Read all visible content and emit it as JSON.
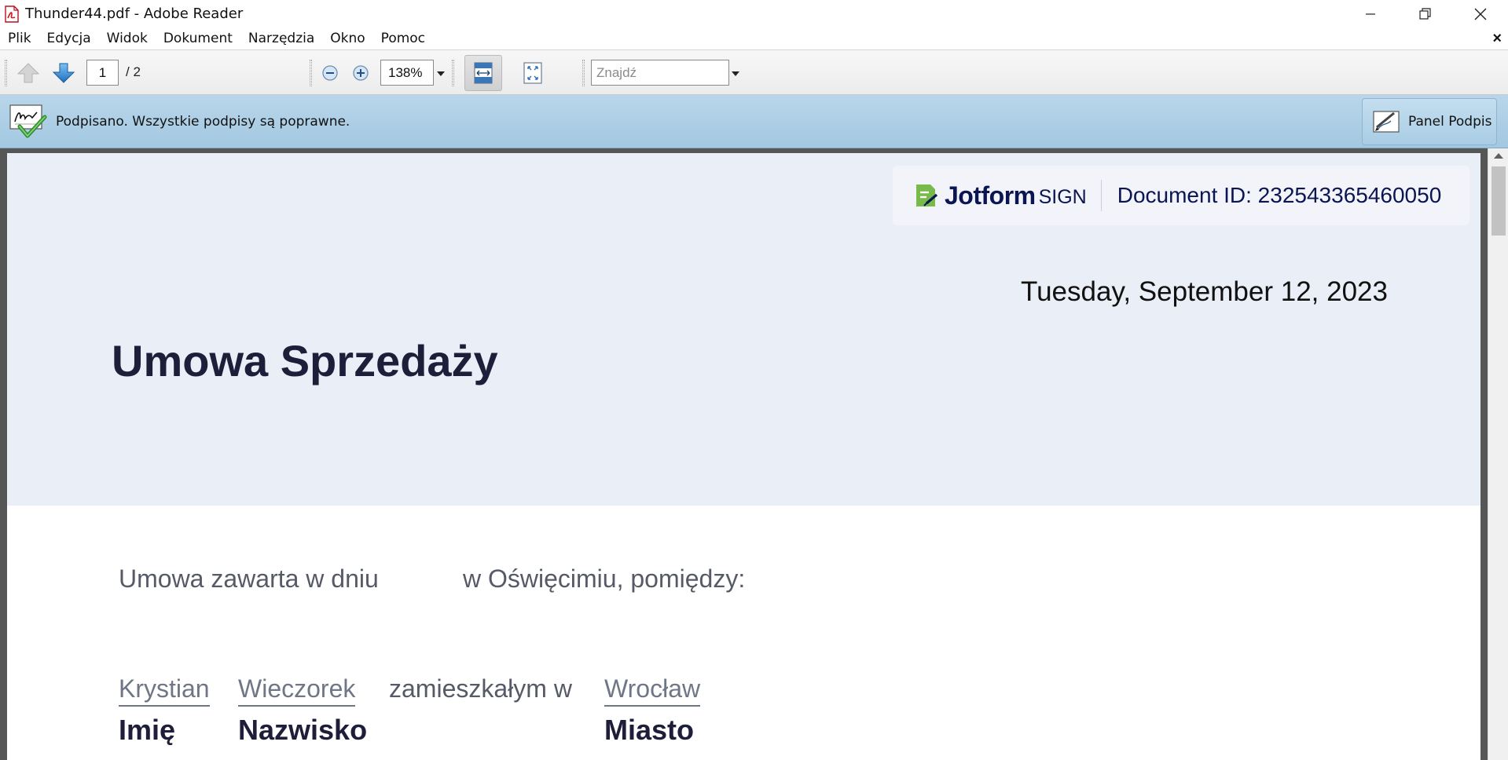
{
  "window": {
    "title": "Thunder44.pdf - Adobe Reader"
  },
  "menu": {
    "items": [
      "Plik",
      "Edycja",
      "Widok",
      "Dokument",
      "Narzędzia",
      "Okno",
      "Pomoc"
    ],
    "close_doc": "×"
  },
  "toolbar": {
    "current_page": "1",
    "page_total": "/  2",
    "zoom_value": "138%",
    "find_placeholder": "Znajdź"
  },
  "signature_bar": {
    "message": "Podpisano. Wszystkie podpisy są poprawne.",
    "panel_button": "Panel Podpis"
  },
  "document": {
    "badge": {
      "brand": "Jotform",
      "brand_suffix": "SIGN",
      "document_id": "Document ID: 232543365460050"
    },
    "date": "Tuesday, September 12, 2023",
    "title": "Umowa Sprzedaży",
    "intro_left": "Umowa zawarta w dniu",
    "intro_right": "w Oświęcimiu, pomiędzy:",
    "party": {
      "first_name": "Krystian",
      "last_name": "Wieczorek",
      "resides_in": "zamieszkałym w",
      "city": "Wrocław",
      "first_name_label": "Imię",
      "last_name_label": "Nazwisko",
      "city_label": "Miasto"
    }
  },
  "colors": {
    "sigbar": "#a9cde4",
    "header_band": "#eaeef6",
    "jotform_navy": "#0a1551",
    "jotform_green": "#78bb4b"
  }
}
